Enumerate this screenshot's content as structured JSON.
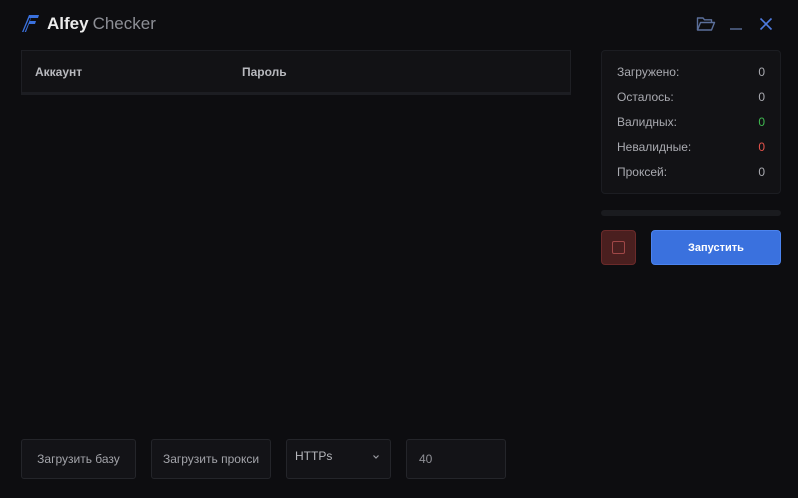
{
  "titlebar": {
    "brand": "Alfey",
    "subtitle": "Checker",
    "icons": [
      "logo-icon",
      "folder-open-icon",
      "minimize-icon",
      "close-icon"
    ]
  },
  "table": {
    "columns": [
      "Аккаунт",
      "Пароль"
    ],
    "rows": []
  },
  "stats": {
    "loaded_label": "Загружено:",
    "loaded_value": "0",
    "remaining_label": "Осталось:",
    "remaining_value": "0",
    "valid_label": "Валидных:",
    "valid_value": "0",
    "invalid_label": "Невалидные:",
    "invalid_value": "0",
    "proxies_label": "Проксей:",
    "proxies_value": "0"
  },
  "progress": {
    "fraction": 0
  },
  "actions": {
    "start_label": "Запустить",
    "stop_icon": "stop-icon"
  },
  "bottom": {
    "load_db_label": "Загрузить базу",
    "load_proxy_label": "Загрузить прокси",
    "proxy_type_value": "HTTPs",
    "threads_value": "40"
  },
  "colors": {
    "background": "#0d0d10",
    "accent": "#3a71de",
    "valid": "#3fb950",
    "invalid": "#e5534b",
    "stop": "#4a1f1f"
  }
}
